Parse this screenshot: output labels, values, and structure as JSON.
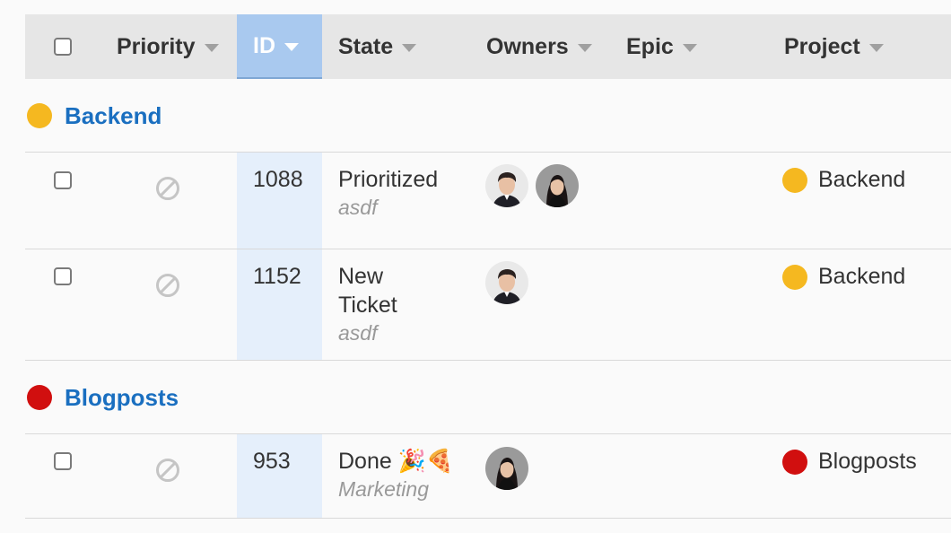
{
  "columns": {
    "priority": "Priority",
    "id": "ID",
    "state": "State",
    "owners": "Owners",
    "epic": "Epic",
    "project": "Project"
  },
  "groups": [
    {
      "name": "Backend",
      "color": "#f5b820",
      "rows": [
        {
          "id": "1088",
          "state": "Prioritized",
          "sub": "asdf",
          "owners": [
            "owner-avatar-man",
            "owner-avatar-woman"
          ],
          "project": "Backend",
          "project_color": "#f5b820"
        },
        {
          "id": "1152",
          "state_line1": "New",
          "state_line2": "Ticket",
          "sub": "asdf",
          "owners": [
            "owner-avatar-man"
          ],
          "project": "Backend",
          "project_color": "#f5b820"
        }
      ]
    },
    {
      "name": "Blogposts",
      "color": "#d10f0f",
      "rows": [
        {
          "id": "953",
          "state": "Done 🎉🍕",
          "sub": "Marketing",
          "owners": [
            "owner-avatar-woman"
          ],
          "project": "Blogposts",
          "project_color": "#d10f0f"
        }
      ]
    }
  ]
}
